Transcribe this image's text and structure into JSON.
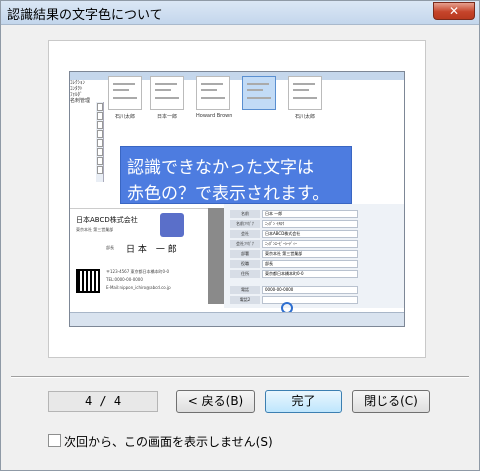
{
  "window": {
    "title": "認識結果の文字色について",
    "close_icon": "✕"
  },
  "preview": {
    "tree_items": [
      "ｺﾚｸｼｮﾝ",
      "ｺﾝﾀｸﾄ",
      "ﾌｫﾙﾀﾞ",
      "名刺管理"
    ],
    "cards": [
      {
        "label": "石川太郎"
      },
      {
        "label": "日本一郎"
      },
      {
        "label": "Howard Brown"
      },
      {
        "label": "",
        "selected": true
      },
      {
        "label": "石川太郎"
      }
    ],
    "banner": {
      "line1": "認識できなかった文字は",
      "line2": "赤色の？で表示されます。"
    },
    "card_scan": {
      "company": "日本ABCD株式会社",
      "dept": "東京本社 第三営業部",
      "role": "部長",
      "name": "日 本　一 郎",
      "address": "〒123-4567 東京都日本橋本町0-0",
      "tel": "TEL:0000-00-0000",
      "email": "E-Mail:nippon_ichiro@abcd.co.jp"
    },
    "form_fields": [
      {
        "label": "名前",
        "value": "日本 一郎"
      },
      {
        "label": "名前ﾌﾘｶﾞﾅ",
        "value": "ﾆｯﾎﾟﾝ ｲﾁﾛｳ"
      },
      {
        "label": "会社",
        "value": "日本ABCD株式会社"
      },
      {
        "label": "会社ﾌﾘｶﾞﾅ",
        "value": "ﾆｯﾎﾟﾝｴｰﾋﾞｰｼｰﾃﾞｨｰ"
      },
      {
        "label": "部署",
        "value": "東京本社 第三営業部"
      },
      {
        "label": "役職",
        "value": "部長"
      },
      {
        "label": "住所",
        "value": "東京都日本橋本町0-0"
      },
      {
        "label": "電話",
        "value": "0000-00-0000"
      },
      {
        "label": "電話2",
        "value": ""
      }
    ]
  },
  "footer": {
    "page_counter": "4 / 4",
    "back_button": "< 戻る(B)",
    "finish_button": "完了",
    "close_button": "閉じる(C)",
    "checkbox_label": "次回から、この画面を表示しません(S)",
    "checkbox_checked": false
  }
}
